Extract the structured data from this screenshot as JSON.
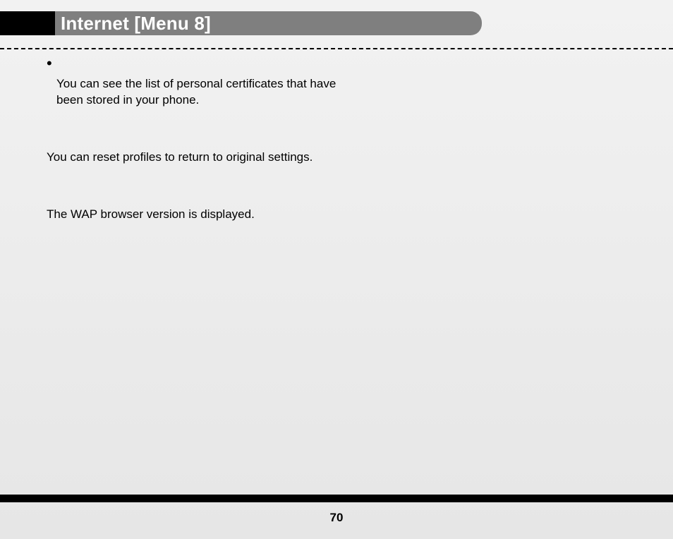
{
  "header": {
    "title": "Internet [Menu 8]"
  },
  "content": {
    "bullet_text": "You can see the list of personal certificates that have been stored in your phone.",
    "para_reset": "You can reset profiles to return to original settings.",
    "para_version": "The WAP browser version is displayed."
  },
  "footer": {
    "page_number": "70"
  }
}
